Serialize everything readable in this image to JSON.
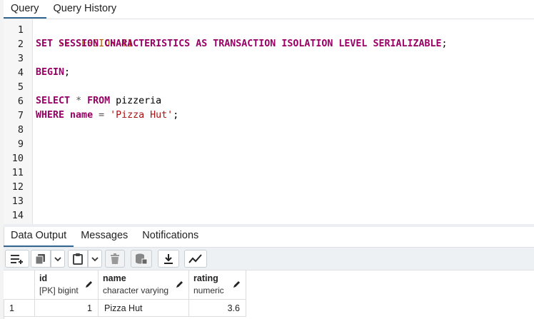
{
  "editor_tabs": [
    {
      "label": "Query"
    },
    {
      "label": "Query History"
    }
  ],
  "editor": {
    "line_numbers": [
      "1",
      "2",
      "3",
      "4",
      "5",
      "6",
      "7",
      "8",
      "9",
      "10",
      "11",
      "12",
      "13",
      "14"
    ]
  },
  "code": {
    "l1": "-- SESSION #1",
    "l2_set": "SET",
    "l2_session": "SESSION",
    "l2_characteristics": "CHARACTERISTICS",
    "l2_as": "AS",
    "l2_transaction": "TRANSACTION",
    "l2_isolation": "ISOLATION",
    "l2_level": "LEVEL",
    "l2_serializable": "SERIALIZABLE",
    "l2_semi": ";",
    "l4_begin": "BEGIN",
    "l4_semi": ";",
    "l6_select": "SELECT",
    "l6_star": "*",
    "l6_from": "FROM",
    "l6_table": "pizzeria",
    "l7_where": "WHERE",
    "l7_name": "name",
    "l7_eq": "=",
    "l7_str": "'Pizza Hut'",
    "l7_semi": ";"
  },
  "result_tabs": [
    {
      "label": "Data Output"
    },
    {
      "label": "Messages"
    },
    {
      "label": "Notifications"
    }
  ],
  "toolbar": {
    "icons": [
      "add-row-icon",
      "copy-icon",
      "dropdown-icon",
      "paste-icon",
      "dropdown-icon",
      "delete-icon",
      "save-data-icon",
      "download-icon",
      "graph-icon"
    ]
  },
  "grid": {
    "columns": [
      {
        "name": "id",
        "type": "[PK] bigint"
      },
      {
        "name": "name",
        "type": "character varying"
      },
      {
        "name": "rating",
        "type": "numeric"
      }
    ],
    "rows": [
      {
        "row_num": "1",
        "id": "1",
        "name": "Pizza Hut",
        "rating": "3.6"
      }
    ]
  },
  "colors": {
    "keyword": "#990066",
    "comment": "#aa5500",
    "string": "#aa1111",
    "active_tab": "#326690"
  }
}
